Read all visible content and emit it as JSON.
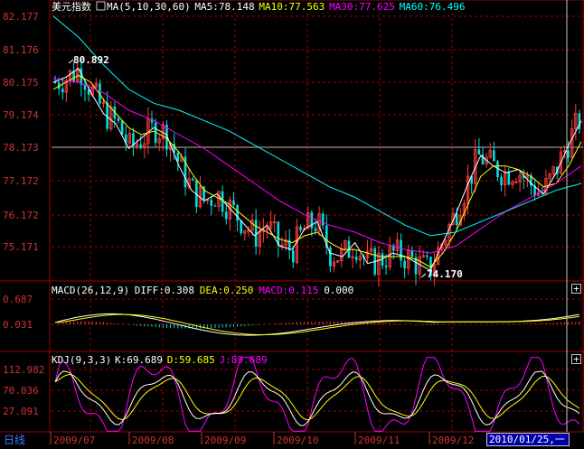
{
  "chart_data": [
    {
      "type": "candlestick",
      "title": "美元指数",
      "indicator": "MA(5,10,30,60)",
      "legend": [
        {
          "text": "MA5:78.148",
          "color": "#ffffff"
        },
        {
          "text": "MA10:77.563",
          "color": "#ffff00"
        },
        {
          "text": "MA30:77.625",
          "color": "#ff00ff"
        },
        {
          "text": "MA60:76.496",
          "color": "#00ffff"
        }
      ],
      "y_ticks": [
        "82.177",
        "81.176",
        "80.175",
        "79.174",
        "78.173",
        "77.172",
        "76.172",
        "75.171"
      ],
      "ylim": [
        74.5,
        82.2
      ],
      "reference_line": 78.173,
      "annotations": [
        {
          "text": "80.892",
          "x": 0.1,
          "y": 80.892
        },
        {
          "text": "74.170",
          "x": 0.753,
          "y": 74.17
        }
      ],
      "series": [
        {
          "name": "MA5",
          "color": "#ffffff",
          "values": [
            [
              0,
              80.2
            ],
            [
              0.05,
              80.35
            ],
            [
              0.1,
              80.6
            ],
            [
              0.15,
              79.9
            ],
            [
              0.2,
              79.3
            ],
            [
              0.25,
              79.0
            ],
            [
              0.3,
              78.3
            ],
            [
              0.35,
              78.6
            ],
            [
              0.4,
              78.9
            ],
            [
              0.45,
              78.7
            ],
            [
              0.5,
              77.8
            ],
            [
              0.55,
              77.1
            ],
            [
              0.6,
              76.8
            ],
            [
              0.65,
              77.0
            ],
            [
              0.7,
              76.6
            ],
            [
              0.75,
              76.2
            ],
            [
              0.8,
              75.8
            ],
            [
              0.85,
              76.1
            ],
            [
              0.9,
              75.5
            ],
            [
              0.95,
              75.4
            ],
            [
              1,
              76.0
            ],
            [
              1.05,
              76.2
            ],
            [
              1.1,
              75.3
            ],
            [
              1.15,
              75.2
            ],
            [
              1.2,
              75.6
            ],
            [
              1.25,
              75.0
            ],
            [
              1.3,
              75.1
            ],
            [
              1.35,
              75.3
            ],
            [
              1.4,
              75.2
            ],
            [
              1.45,
              75.0
            ],
            [
              1.5,
              74.8
            ],
            [
              1.55,
              75.6
            ],
            [
              1.6,
              76.4
            ],
            [
              1.65,
              77.3
            ],
            [
              1.7,
              78.1
            ],
            [
              1.75,
              77.8
            ],
            [
              1.8,
              77.6
            ],
            [
              1.85,
              77.7
            ],
            [
              1.9,
              77.3
            ],
            [
              1.95,
              77.0
            ],
            [
              2.0,
              77.6
            ],
            [
              2.05,
              78.4
            ],
            [
              2.1,
              79.1
            ]
          ]
        },
        {
          "name": "MA10",
          "color": "#ffff00",
          "values": [
            [
              0,
              80.0
            ],
            [
              0.05,
              80.2
            ],
            [
              0.1,
              80.4
            ],
            [
              0.15,
              80.2
            ],
            [
              0.2,
              79.7
            ],
            [
              0.25,
              79.3
            ],
            [
              0.3,
              78.9
            ],
            [
              0.35,
              78.7
            ],
            [
              0.4,
              78.8
            ],
            [
              0.45,
              78.6
            ],
            [
              0.5,
              78.2
            ],
            [
              0.55,
              77.6
            ],
            [
              0.6,
              77.1
            ],
            [
              0.65,
              76.9
            ],
            [
              0.7,
              76.7
            ],
            [
              0.75,
              76.4
            ],
            [
              0.8,
              76.1
            ],
            [
              0.85,
              75.9
            ],
            [
              0.9,
              75.7
            ],
            [
              0.95,
              75.6
            ],
            [
              1,
              75.8
            ],
            [
              1.05,
              75.9
            ],
            [
              1.1,
              75.6
            ],
            [
              1.15,
              75.4
            ],
            [
              1.2,
              75.4
            ],
            [
              1.25,
              75.3
            ],
            [
              1.3,
              75.2
            ],
            [
              1.35,
              75.2
            ],
            [
              1.4,
              75.2
            ],
            [
              1.45,
              75.1
            ],
            [
              1.5,
              74.9
            ],
            [
              1.55,
              75.3
            ],
            [
              1.6,
              75.9
            ],
            [
              1.65,
              76.7
            ],
            [
              1.7,
              77.5
            ],
            [
              1.75,
              77.8
            ],
            [
              1.8,
              77.8
            ],
            [
              1.85,
              77.7
            ],
            [
              1.9,
              77.5
            ],
            [
              1.95,
              77.2
            ],
            [
              2.0,
              77.3
            ],
            [
              2.05,
              77.8
            ],
            [
              2.1,
              78.5
            ]
          ]
        },
        {
          "name": "MA30",
          "color": "#ff00ff",
          "values": [
            [
              0,
              80.3
            ],
            [
              0.1,
              80.2
            ],
            [
              0.2,
              79.9
            ],
            [
              0.3,
              79.4
            ],
            [
              0.4,
              79.1
            ],
            [
              0.5,
              78.7
            ],
            [
              0.6,
              78.3
            ],
            [
              0.7,
              77.8
            ],
            [
              0.8,
              77.3
            ],
            [
              0.9,
              76.8
            ],
            [
              1.0,
              76.4
            ],
            [
              1.1,
              76.1
            ],
            [
              1.2,
              75.9
            ],
            [
              1.3,
              75.6
            ],
            [
              1.4,
              75.4
            ],
            [
              1.5,
              75.3
            ],
            [
              1.6,
              75.5
            ],
            [
              1.7,
              76.0
            ],
            [
              1.8,
              76.5
            ],
            [
              1.9,
              76.9
            ],
            [
              2.0,
              77.3
            ],
            [
              2.1,
              77.8
            ]
          ]
        },
        {
          "name": "MA60",
          "color": "#00ffff",
          "values": [
            [
              0,
              82.1
            ],
            [
              0.1,
              81.5
            ],
            [
              0.2,
              80.7
            ],
            [
              0.3,
              80.0
            ],
            [
              0.4,
              79.6
            ],
            [
              0.5,
              79.4
            ],
            [
              0.6,
              79.1
            ],
            [
              0.7,
              78.8
            ],
            [
              0.8,
              78.4
            ],
            [
              0.9,
              78.0
            ],
            [
              1.0,
              77.6
            ],
            [
              1.1,
              77.2
            ],
            [
              1.2,
              76.9
            ],
            [
              1.3,
              76.5
            ],
            [
              1.4,
              76.1
            ],
            [
              1.5,
              75.8
            ],
            [
              1.6,
              75.9
            ],
            [
              1.7,
              76.2
            ],
            [
              1.8,
              76.5
            ],
            [
              1.9,
              76.8
            ],
            [
              2.0,
              77.1
            ],
            [
              2.1,
              77.3
            ]
          ]
        }
      ]
    },
    {
      "type": "bar",
      "title": "MACD(26,12,9)",
      "legend": [
        {
          "text": "DIFF:0.308",
          "color": "#ffffff"
        },
        {
          "text": "DEA:0.250",
          "color": "#ffff00"
        },
        {
          "text": "MACD:0.115",
          "color": "#ff00ff"
        },
        {
          "text": "0.000",
          "color": "#ffffff"
        }
      ],
      "y_ticks": [
        "0.687",
        "0.031"
      ],
      "ylim": [
        -0.45,
        0.95
      ],
      "zero_line": 0.031
    },
    {
      "type": "line",
      "title": "KDJ(9,3,3)",
      "legend": [
        {
          "text": "K:69.689",
          "color": "#ffffff"
        },
        {
          "text": "D:59.685",
          "color": "#ffff00"
        },
        {
          "text": "J:89.689",
          "color": "#ff00ff"
        }
      ],
      "y_ticks": [
        "112.982",
        "70.036",
        "27.091"
      ],
      "ylim": [
        0,
        125
      ]
    }
  ],
  "x_axis": {
    "labels": [
      "2009/07",
      "2009/08",
      "2009/09",
      "2009/10",
      "2009/11",
      "2009/12"
    ]
  },
  "period_tab": "日线",
  "cursor_date": "2010/01/25,一"
}
